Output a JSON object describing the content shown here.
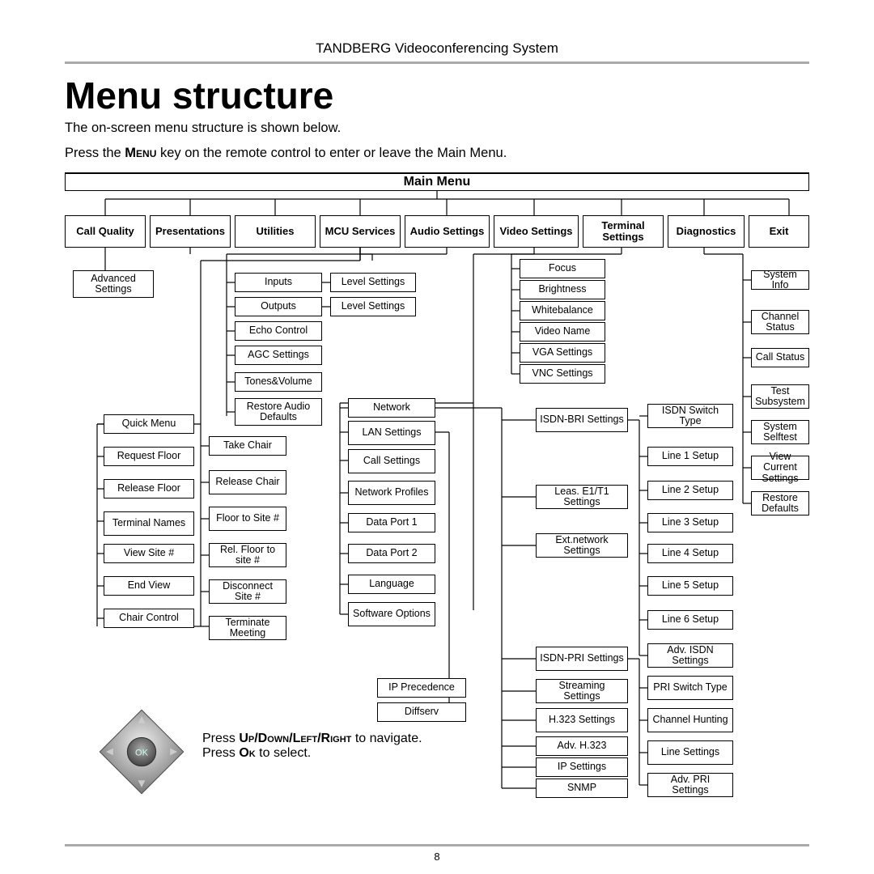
{
  "doc": {
    "header": "TANDBERG Videoconferencing System",
    "title": "Menu structure",
    "intro1": "The on-screen menu structure is shown below.",
    "intro2a": "Press the ",
    "intro2key": "Menu",
    "intro2b": " key on the remote control to enter or leave the Main Menu.",
    "page_number": "8"
  },
  "root": "Main Menu",
  "categories": [
    "Call Quality",
    "Presentations",
    "Utilities",
    "MCU Services",
    "Audio Settings",
    "Video Settings",
    "Terminal Settings",
    "Diagnostics",
    "Exit"
  ],
  "call_quality": [
    "Advanced Settings"
  ],
  "mcu_left": [
    "Quick Menu",
    "Request Floor",
    "Release Floor",
    "Terminal Names",
    "View Site #",
    "End View",
    "Chair Control"
  ],
  "mcu_right": [
    "Take Chair",
    "Release Chair",
    "Floor to Site #",
    "Rel. Floor to site #",
    "Disconnect Site #",
    "Terminate Meeting"
  ],
  "audio_left": [
    "Inputs",
    "Outputs",
    "Echo Control",
    "AGC Settings",
    "Tones&Volume",
    "Restore Audio Defaults"
  ],
  "audio_right": [
    "Level Settings",
    "Level Settings"
  ],
  "terminal_col": [
    "Network",
    "LAN Settings",
    "Call Settings",
    "Network Profiles",
    "Data Port 1",
    "Data Port 2",
    "Language",
    "Software Options"
  ],
  "lan_sub": [
    "IP Precedence",
    "Diffserv"
  ],
  "video": [
    "Focus",
    "Brightness",
    "Whitebalance",
    "Video Name",
    "VGA Settings",
    "VNC Settings"
  ],
  "network_mid": [
    "ISDN-BRI Settings",
    "Leas. E1/T1 Settings",
    "Ext.network Settings",
    "ISDN-PRI Settings",
    "Streaming Settings",
    "H.323 Settings",
    "Adv. H.323",
    "IP Settings",
    "SNMP"
  ],
  "isdn_bri_sub": [
    "ISDN Switch Type",
    "Line 1 Setup",
    "Line 2 Setup",
    "Line 3 Setup",
    "Line 4 Setup",
    "Line 5 Setup",
    "Line 6 Setup",
    "Adv. ISDN Settings"
  ],
  "isdn_pri_sub": [
    "PRI Switch Type",
    "Channel Hunting",
    "Line Settings",
    "Adv. PRI Settings"
  ],
  "diagnostics": [
    "System Info",
    "Channel Status",
    "Call Status",
    "Test Subsystem",
    "System Selftest",
    "View Current Settings",
    "Restore Defaults"
  ],
  "nav": {
    "line1a": "Press ",
    "line1keys": "Up/Down/Left/Right",
    "line1b": " to navigate.",
    "line2a": "Press ",
    "line2key": "Ok",
    "line2b": " to select.",
    "ok": "OK"
  }
}
